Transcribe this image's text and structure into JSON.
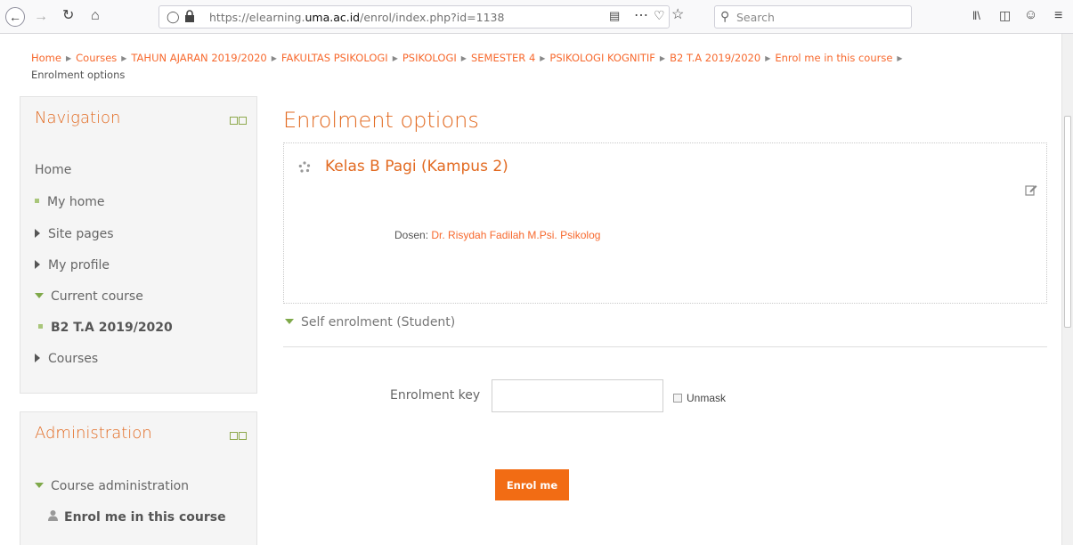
{
  "browser": {
    "url_prefix": "https://elearning.",
    "url_domain": "uma.ac.id",
    "url_path": "/enrol/index.php?id=1138",
    "search_placeholder": "Search"
  },
  "breadcrumb": {
    "items": [
      "Home",
      "Courses",
      "TAHUN AJARAN 2019/2020",
      "FAKULTAS PSIKOLOGI",
      "PSIKOLOGI",
      "SEMESTER 4",
      "PSIKOLOGI KOGNITIF",
      "B2 T.A 2019/2020",
      "Enrol me in this course"
    ],
    "current": "Enrolment options"
  },
  "navigation": {
    "title": "Navigation",
    "home": "Home",
    "my_home": "My home",
    "site_pages": "Site pages",
    "my_profile": "My profile",
    "current_course": "Current course",
    "course_short": "B2 T.A 2019/2020",
    "courses": "Courses"
  },
  "administration": {
    "title": "Administration",
    "course_admin": "Course administration",
    "enrol_me": "Enrol me in this course"
  },
  "main": {
    "title": "Enrolment options",
    "course_name": "Kelas B Pagi (Kampus 2)",
    "teacher_label": "Dosen:",
    "teacher_name": "Dr. Risydah Fadilah M.Psi. Psikolog",
    "section_title": "Self enrolment (Student)",
    "key_label": "Enrolment key",
    "key_value": "",
    "unmask_label": "Unmask",
    "enrol_button": "Enrol me"
  },
  "colors": {
    "accent": "#e26a21",
    "button": "#f26c14",
    "bullet": "#a9c67a"
  }
}
